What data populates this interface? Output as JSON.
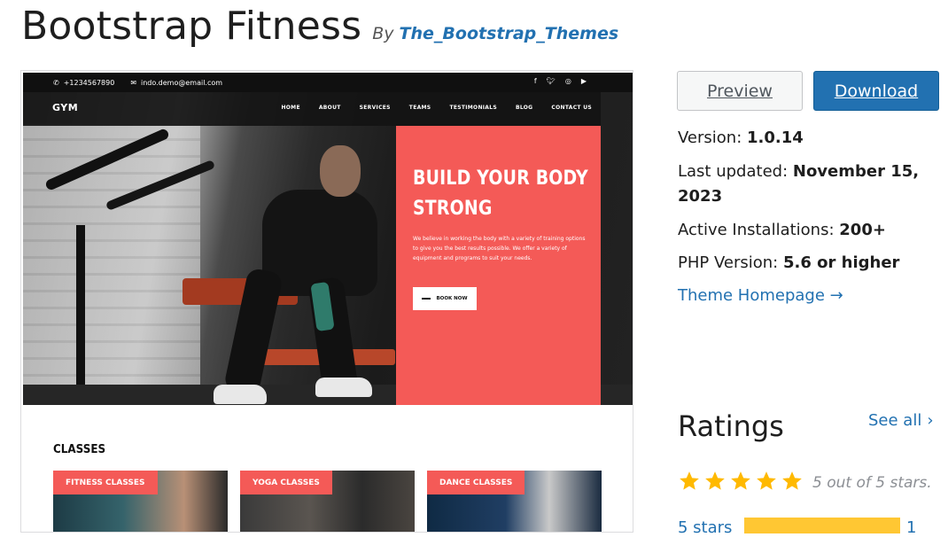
{
  "header": {
    "theme_name": "Bootstrap Fitness",
    "by_prefix": "By",
    "author": "The_Bootstrap_Themes"
  },
  "screenshot": {
    "topbar": {
      "phone": "+1234567890",
      "email": "indo.demo@email.com",
      "socials": [
        "facebook-icon",
        "twitter-icon",
        "instagram-icon",
        "youtube-icon"
      ]
    },
    "nav": {
      "logo": "GYM",
      "links": [
        "HOME",
        "ABOUT",
        "SERVICES",
        "TEAMS",
        "TESTIMONIALS",
        "BLOG",
        "CONTACT US"
      ]
    },
    "hero": {
      "headline_line1": "BUILD YOUR BODY",
      "headline_line2": "STRONG",
      "body": "We believe in working the body with a variety of training options to give you the best results possible. We offer a variety of equipment and programs to suit your needs.",
      "button": "BOOK NOW",
      "accent_color": "#f45a57"
    },
    "classes": {
      "title": "CLASSES",
      "cards": [
        "FITNESS CLASSES",
        "YOGA CLASSES",
        "DANCE CLASSES"
      ]
    }
  },
  "actions": {
    "preview": "Preview",
    "download": "Download"
  },
  "meta": {
    "version_label": "Version:",
    "version_value": "1.0.14",
    "updated_label": "Last updated:",
    "updated_value": "November 15, 2023",
    "installs_label": "Active Installations:",
    "installs_value": "200+",
    "php_label": "PHP Version:",
    "php_value": "5.6 or higher",
    "homepage_link": "Theme Homepage →"
  },
  "ratings": {
    "title": "Ratings",
    "see_all": "See all",
    "stars_filled": 5,
    "stars_text": "5 out of 5 stars.",
    "breakdown": [
      {
        "label": "5 stars",
        "count": "1",
        "fraction": 1.0
      }
    ],
    "star_color": "#ffb900",
    "bar_color": "#ffc733"
  },
  "colors": {
    "link": "#2271b1",
    "download_bg": "#2271b1"
  }
}
